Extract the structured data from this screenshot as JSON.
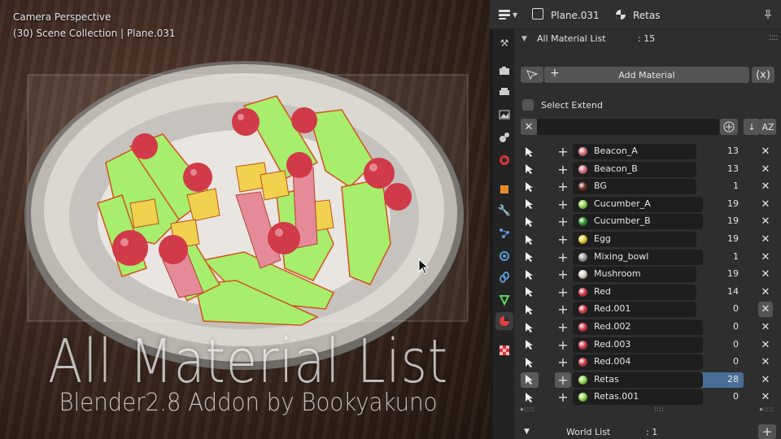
{
  "viewport": {
    "mode": "Camera Perspective",
    "context": "(30) Scene Collection | Plane.031",
    "overlay_title": "All Material List",
    "overlay_subtitle": "Blender2.8 Addon by Bookyakuno"
  },
  "properties_header": {
    "object_name": "Plane.031",
    "material_name": "Retas"
  },
  "panel": {
    "title": "All Material List",
    "count": ": 15",
    "add_material_label": "Add Material",
    "x_button_label": "(x)",
    "select_extend_label": "Select Extend",
    "select_extend_checked": false,
    "filter_value": "",
    "world_list_title": "World List",
    "world_count": ": 1",
    "materials": [
      {
        "name": "Beacon_A",
        "count": "13",
        "color": "#d9727f"
      },
      {
        "name": "Beacon_B",
        "count": "13",
        "color": "#d9727f"
      },
      {
        "name": "BG",
        "count": "1",
        "color": "#6b2a1c"
      },
      {
        "name": "Cucumber_A",
        "count": "19",
        "color": "#8fd94a"
      },
      {
        "name": "Cucumber_B",
        "count": "19",
        "color": "#2f8f2a"
      },
      {
        "name": "Egg",
        "count": "19",
        "color": "#e6c836"
      },
      {
        "name": "Mixing_bowl",
        "count": "1",
        "color": "#9a9a9a"
      },
      {
        "name": "Mushroom",
        "count": "19",
        "color": "#d8d3c0"
      },
      {
        "name": "Red",
        "count": "14",
        "color": "#d13a48"
      },
      {
        "name": "Red.001",
        "count": "0",
        "color": "#d13a48"
      },
      {
        "name": "Red.002",
        "count": "0",
        "color": "#d13a48"
      },
      {
        "name": "Red.003",
        "count": "0",
        "color": "#d13a48"
      },
      {
        "name": "Red.004",
        "count": "0",
        "color": "#d13a48"
      },
      {
        "name": "Retas",
        "count": "28",
        "color": "#8fd94a"
      },
      {
        "name": "Retas.001",
        "count": "0",
        "color": "#8fd94a"
      }
    ],
    "active_index": 13,
    "hovered_x_index": 9
  },
  "colors": {
    "selection": "#4a6e95",
    "panel_bg": "#2e2e2e"
  }
}
